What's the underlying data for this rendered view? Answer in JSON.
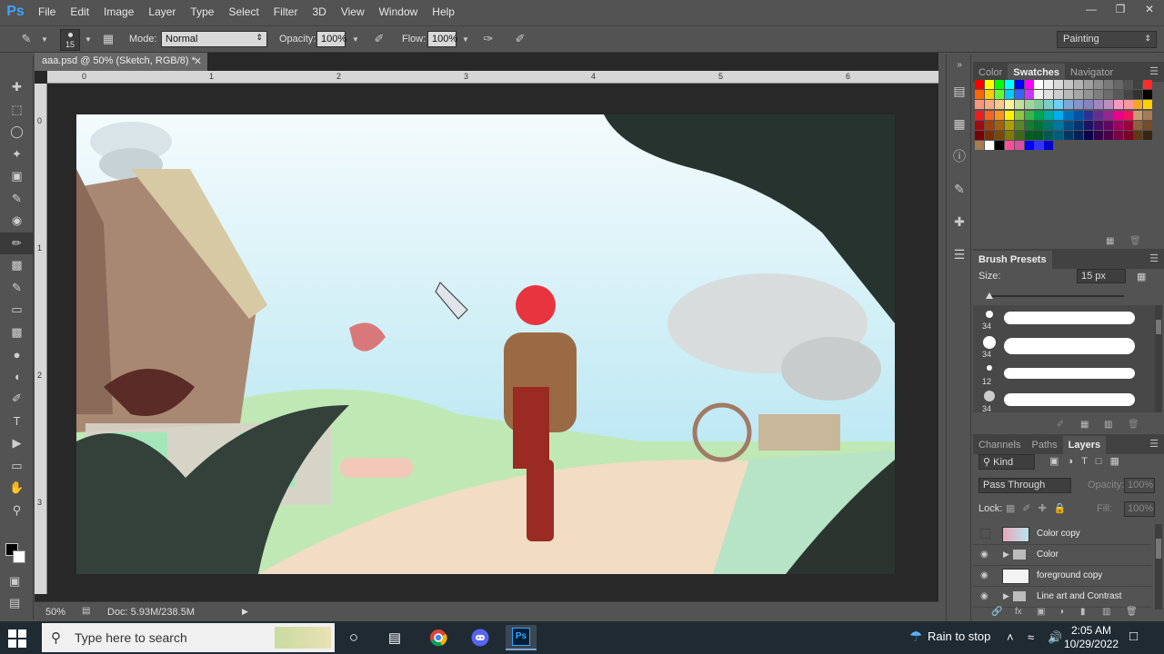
{
  "app": {
    "logo": "Ps"
  },
  "menu": [
    "File",
    "Edit",
    "Image",
    "Layer",
    "Type",
    "Select",
    "Filter",
    "3D",
    "View",
    "Window",
    "Help"
  ],
  "window_controls": [
    "minimize-icon",
    "restore-icon",
    "close-icon"
  ],
  "options": {
    "brush_size": "15",
    "mode_label": "Mode:",
    "mode_value": "Normal",
    "opacity_label": "Opacity:",
    "opacity_value": "100%",
    "flow_label": "Flow:",
    "flow_value": "100%",
    "workspace": "Painting"
  },
  "tools": [
    "move-tool-icon",
    "marquee-tool-icon",
    "lasso-tool-icon",
    "quick-select-tool-icon",
    "crop-tool-icon",
    "eyedropper-tool-icon",
    "healing-tool-icon",
    "brush-tool-icon",
    "clone-stamp-tool-icon",
    "history-brush-tool-icon",
    "eraser-tool-icon",
    "gradient-tool-icon",
    "blur-tool-icon",
    "dodge-tool-icon",
    "pen-tool-icon",
    "type-tool-icon",
    "path-select-tool-icon",
    "shape-tool-icon",
    "hand-tool-icon",
    "zoom-tool-icon"
  ],
  "document": {
    "tab_title": "aaa.psd @ 50% (Sketch, RGB/8) *",
    "ruler_top": [
      "0",
      "1",
      "2",
      "3",
      "4",
      "5",
      "6"
    ],
    "ruler_left": [
      "0",
      "1",
      "2",
      "3"
    ],
    "zoom": "50%",
    "doc_size": "Doc: 5.93M/238.5M"
  },
  "panels": {
    "color_tabs": [
      "Color",
      "Swatches",
      "Navigator"
    ],
    "brush_presets_title": "Brush Presets",
    "size_label": "Size:",
    "size_value": "15 px",
    "brushes": [
      {
        "size": "34"
      },
      {
        "size": "34"
      },
      {
        "size": "12"
      },
      {
        "size": "34"
      }
    ],
    "layers_tabs": [
      "Channels",
      "Paths",
      "Layers"
    ],
    "kind_label": "Kind",
    "blend_mode": "Pass Through",
    "opacity_label": "Opacity:",
    "opacity_value": "100%",
    "lock_label": "Lock:",
    "fill_label": "Fill:",
    "fill_value": "100%",
    "layers": [
      {
        "name": "Color copy",
        "type": "layer",
        "visible": false
      },
      {
        "name": "Color",
        "type": "group",
        "visible": true
      },
      {
        "name": "foreground copy",
        "type": "layer",
        "visible": true
      },
      {
        "name": "Line art and Contrast",
        "type": "group",
        "visible": true
      }
    ]
  },
  "swatch_colors": [
    "#ff0000",
    "#ffff00",
    "#00ff00",
    "#00ffff",
    "#0000ff",
    "#ff00ff",
    "#ffffff",
    "#ececec",
    "#d9d9d9",
    "#c6c6c6",
    "#b3b3b3",
    "#a0a0a0",
    "#8d8d8d",
    "#7a7a7a",
    "#676767",
    "#545454",
    "#414141",
    "#ff2a2a",
    "#ff6600",
    "#ffcc00",
    "#66ff33",
    "#00ccff",
    "#3366ff",
    "#cc33ff",
    "#f2f2f2",
    "#e0e0e0",
    "#cdcdcd",
    "#b9b9b9",
    "#a6a6a6",
    "#939393",
    "#7f7f7f",
    "#6c6c6c",
    "#595959",
    "#464646",
    "#333333",
    "#000000",
    "#f7977a",
    "#f9ad81",
    "#fdc68a",
    "#fff79a",
    "#c4df9b",
    "#a2d39c",
    "#82ca9d",
    "#7bcdc8",
    "#6ecff6",
    "#7ea7d8",
    "#8493ca",
    "#8882be",
    "#a187be",
    "#bc8dbf",
    "#f49ac2",
    "#f6989d",
    "#f5a623",
    "#ffd000",
    "#ed1c24",
    "#f26522",
    "#f7941d",
    "#fff200",
    "#8dc63f",
    "#39b54a",
    "#00a651",
    "#00a99d",
    "#00aeef",
    "#0072bc",
    "#0054a6",
    "#2e3192",
    "#662d91",
    "#92278f",
    "#ec008c",
    "#ed145b",
    "#c69c6d",
    "#a67c52",
    "#9e0b0f",
    "#a0410d",
    "#a36209",
    "#aba000",
    "#598527",
    "#1a7b30",
    "#007236",
    "#00746b",
    "#0076a3",
    "#004b80",
    "#003471",
    "#1b1464",
    "#440e62",
    "#630460",
    "#9e005d",
    "#9e0039",
    "#8c6239",
    "#754c24",
    "#790000",
    "#7b2e00",
    "#7d4900",
    "#827b00",
    "#406618",
    "#005e20",
    "#005826",
    "#005952",
    "#005b7f",
    "#003663",
    "#002157",
    "#0d004c",
    "#32004b",
    "#4b0049",
    "#7b0046",
    "#7a0026",
    "#603913",
    "#3c2415",
    "#a67c52",
    "#ffffff",
    "#000000",
    "#ff4f9b",
    "#d94f9b",
    "#0000ff",
    "#3333ff",
    "#0000cc"
  ],
  "taskbar": {
    "search_placeholder": "Type here to search",
    "weather": "Rain to stop",
    "time": "2:05 AM",
    "date": "10/29/2022"
  }
}
